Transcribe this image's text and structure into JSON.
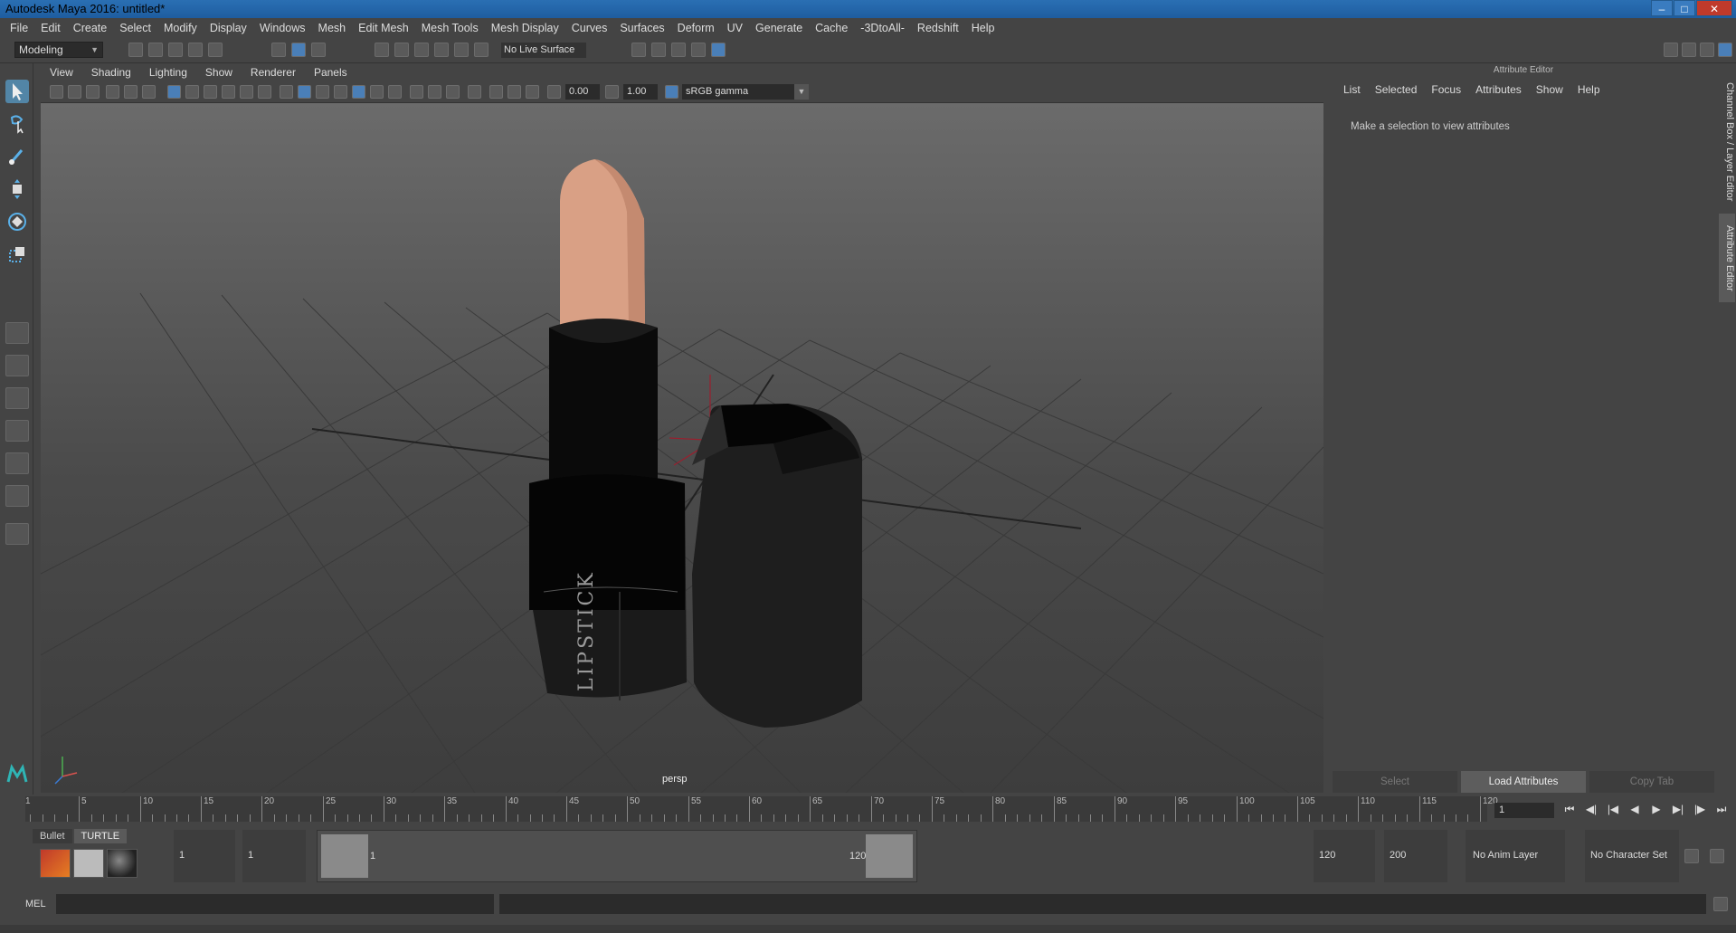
{
  "window": {
    "title": "Autodesk Maya 2016: untitled*"
  },
  "menubar": [
    "File",
    "Edit",
    "Create",
    "Select",
    "Modify",
    "Display",
    "Windows",
    "Mesh",
    "Edit Mesh",
    "Mesh Tools",
    "Mesh Display",
    "Curves",
    "Surfaces",
    "Deform",
    "UV",
    "Generate",
    "Cache",
    "-3DtoAll-",
    "Redshift",
    "Help"
  ],
  "statusline": {
    "menuset": "Modeling",
    "live_surface": "No Live Surface"
  },
  "viewport": {
    "menu": [
      "View",
      "Shading",
      "Lighting",
      "Show",
      "Renderer",
      "Panels"
    ],
    "exposure": "0.00",
    "gamma": "1.00",
    "color_space": "sRGB gamma",
    "camera": "persp",
    "label_text": "LIPSTICK"
  },
  "attribute_editor": {
    "title": "Attribute Editor",
    "menu": [
      "List",
      "Selected",
      "Focus",
      "Attributes",
      "Show",
      "Help"
    ],
    "message": "Make a selection to view attributes",
    "buttons": [
      "Select",
      "Load Attributes",
      "Copy Tab"
    ]
  },
  "side_tabs": [
    "Channel Box / Layer Editor",
    "Attribute Editor"
  ],
  "timeline": {
    "ticks": [
      "5",
      "10",
      "15",
      "20",
      "25",
      "30",
      "35",
      "40",
      "45",
      "50",
      "55",
      "60",
      "65",
      "70",
      "75",
      "80",
      "85",
      "90",
      "95",
      "100",
      "105",
      "110",
      "115",
      "120"
    ],
    "current_frame": "1",
    "start_marker": "1"
  },
  "shelf": {
    "tabs": [
      "Bullet",
      "TURTLE"
    ]
  },
  "range": {
    "start": "1",
    "playback_start": "1",
    "slider_start": "1",
    "slider_end": "120",
    "playback_end": "120",
    "end": "200",
    "anim_layer": "No Anim Layer",
    "character_set": "No Character Set"
  },
  "command": {
    "lang": "MEL"
  }
}
